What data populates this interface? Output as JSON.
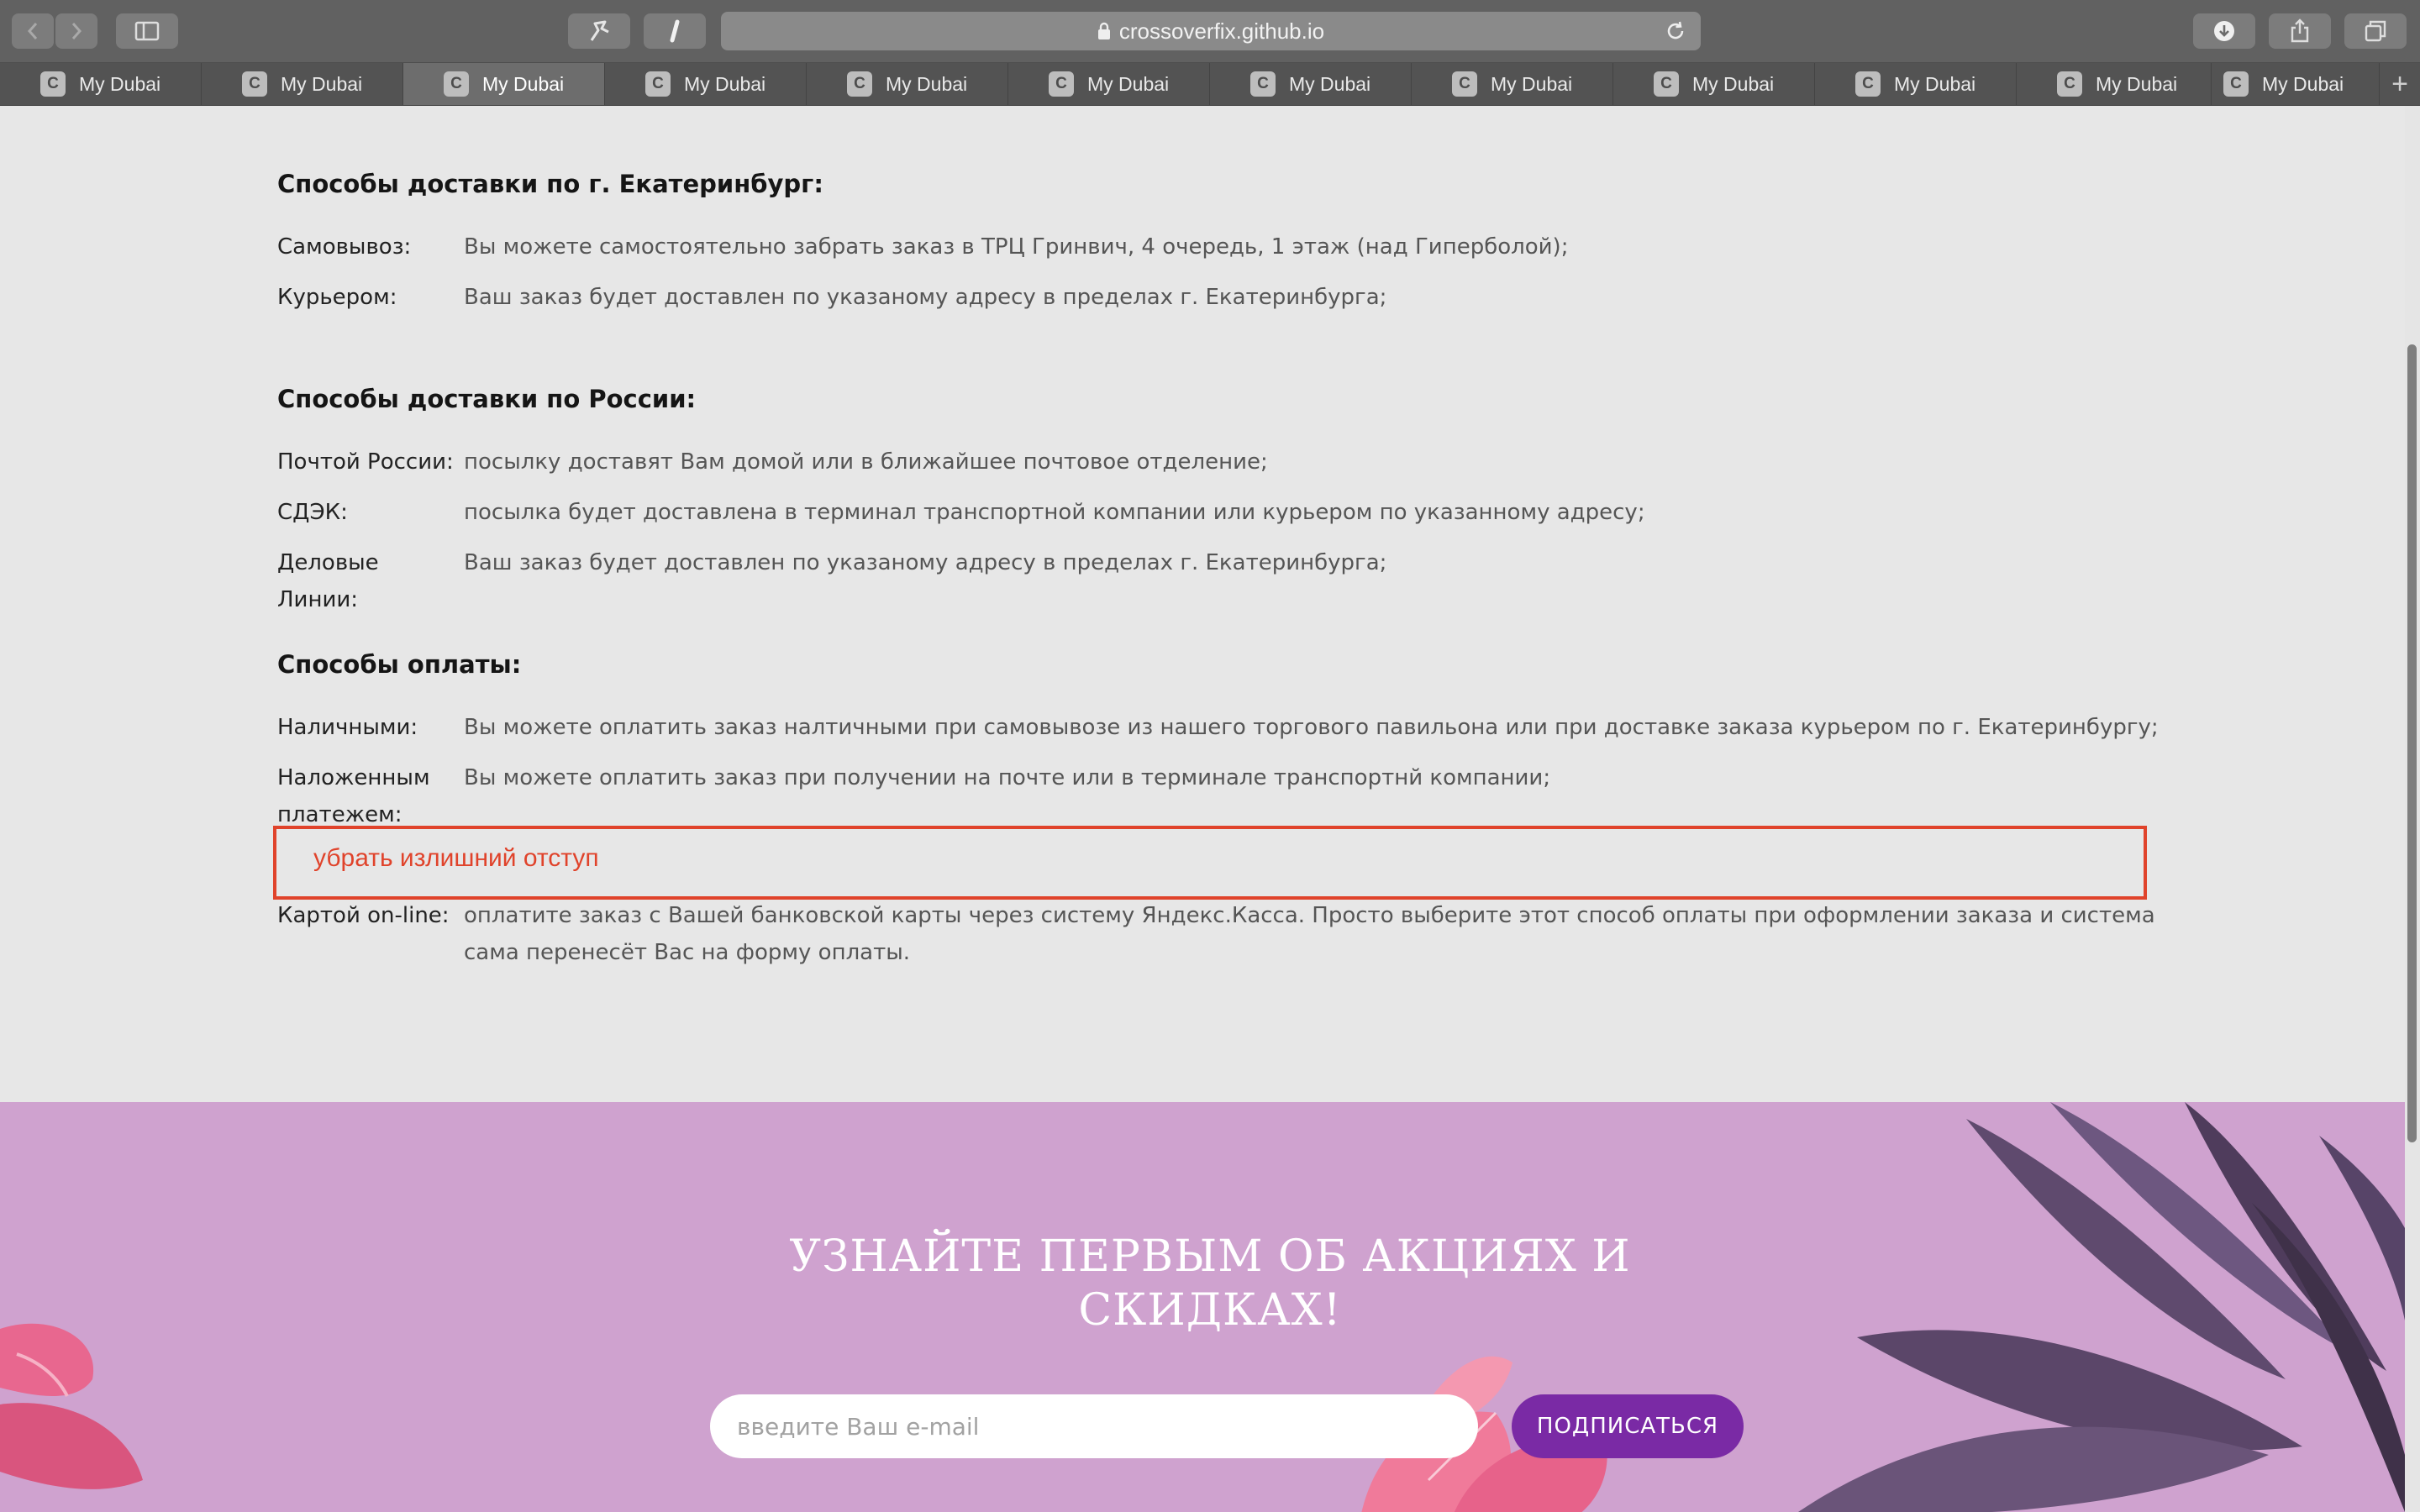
{
  "browser": {
    "address": "crossoverfix.github.io",
    "tab_title": "My Dubai",
    "favicon_letter": "C",
    "tabs": [
      "My Dubai",
      "My Dubai",
      "My Dubai",
      "My Dubai",
      "My Dubai",
      "My Dubai",
      "My Dubai",
      "My Dubai",
      "My Dubai",
      "My Dubai",
      "My Dubai",
      "My Dubai"
    ],
    "active_tab_index": 2
  },
  "delivery_ekb": {
    "heading": "Способы доставки по г. Екатеринбург:",
    "rows": [
      {
        "label": "Самовывоз:",
        "text": "Вы можете самостоятельно забрать заказ в ТРЦ Гринвич, 4 очередь, 1 этаж (над Гиперболой);"
      },
      {
        "label": "Курьером:",
        "text": "Ваш заказ будет доставлен по указаному адресу в пределах г. Екатеринбурга;"
      }
    ]
  },
  "delivery_russia": {
    "heading": "Способы доставки по России:",
    "rows": [
      {
        "label": "Почтой России:",
        "text": "посылку доставят Вам домой или в ближайшее почтовое отделение;"
      },
      {
        "label": "СДЭК:",
        "text": "посылка будет доставлена в терминал транспортной компании или курьером по указанному адресу;"
      },
      {
        "label": "Деловые Линии:",
        "text": "Ваш заказ будет доставлен по указаному адресу в пределах г. Екатеринбурга;"
      }
    ]
  },
  "payment": {
    "heading": "Способы оплаты:",
    "rows": [
      {
        "label": "Наличными:",
        "text": "Вы можете оплатить заказ налтичными при самовывозе из нашего торгового павильона или при доставке заказа курьером по г. Екатеринбургу;"
      },
      {
        "label": "Наложенным платежем:",
        "text": "Вы можете оплатить заказ при получении на почте или в терминале транспортнй компании;"
      },
      {
        "label": "Картой on-line:",
        "text": "оплатите заказ с Вашей банковской карты через систему Яндекс.Касса. Просто выберите этот способ оплаты при оформлении заказа и система сама перенесёт Вас на форму оплаты."
      }
    ]
  },
  "annotation": {
    "text": "убрать излишний отступ",
    "color": "#e0432b"
  },
  "subscribe": {
    "title": "УЗНАЙТЕ ПЕРВЫМ ОБ АКЦИЯХ И СКИДКАХ!",
    "email_placeholder": "введите Ваш e-mail",
    "button_label": "ПОДПИСАТЬСЯ",
    "background": "#cfa2cf",
    "button_color": "#7a2aa5"
  }
}
